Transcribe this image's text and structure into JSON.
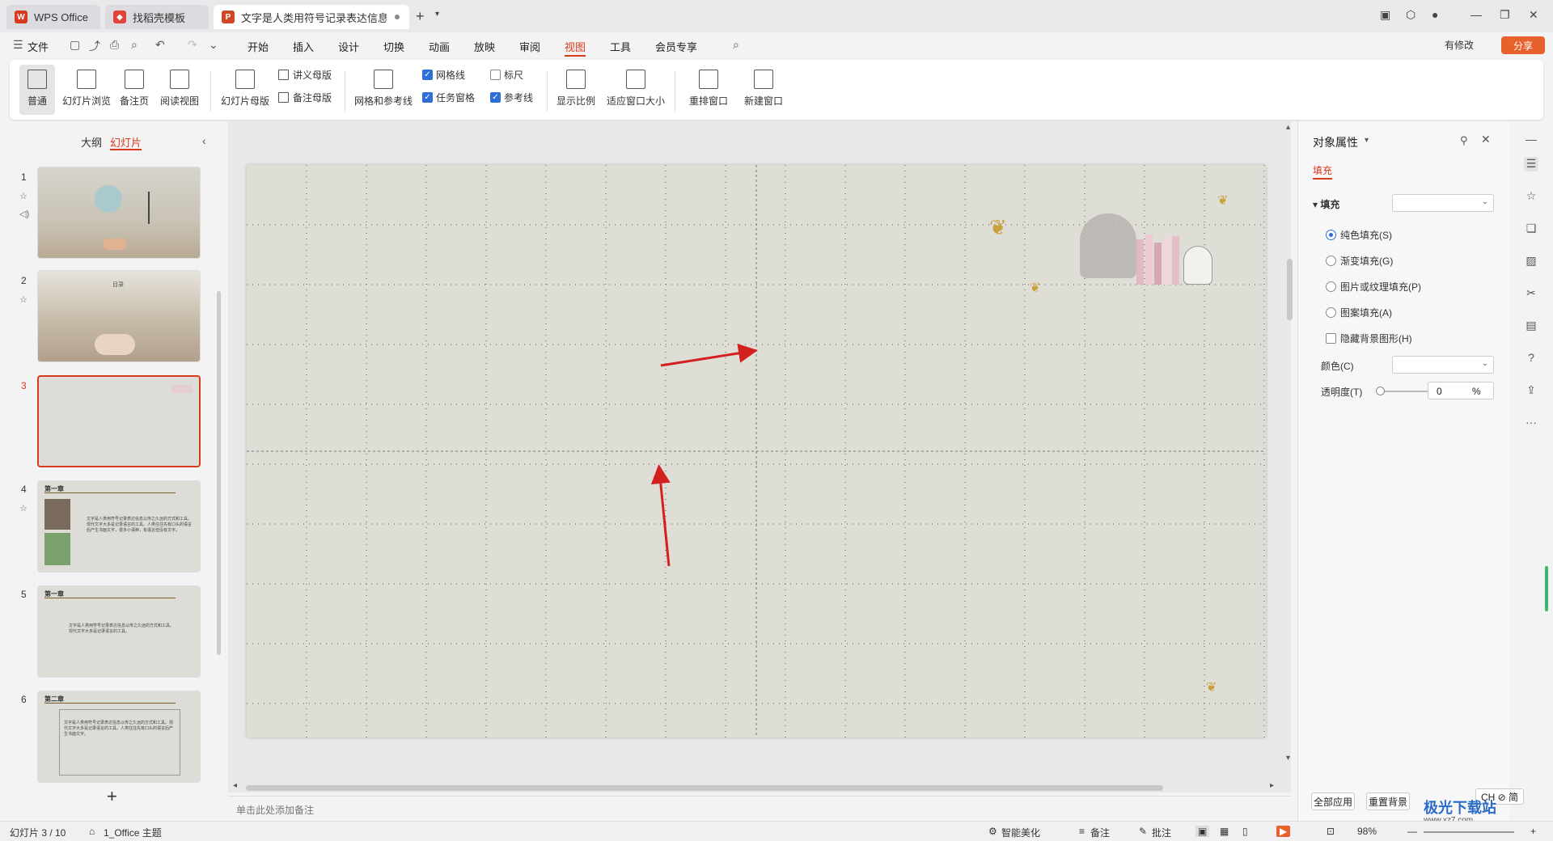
{
  "tabs": [
    {
      "label": "WPS Office",
      "icon": "wps-logo-icon",
      "color": "#d83a1f"
    },
    {
      "label": "找稻壳模板",
      "icon": "docer-icon",
      "color": "#e0443a"
    },
    {
      "label": "文字是人类用符号记录表达信息以",
      "icon": "presentation-icon",
      "color": "#d24726"
    }
  ],
  "menu": {
    "file": "文件",
    "items": [
      "开始",
      "插入",
      "设计",
      "切换",
      "动画",
      "放映",
      "审阅",
      "视图",
      "工具",
      "会员专享"
    ],
    "active": "视图",
    "modified": "有修改",
    "share": "分享"
  },
  "ribbon": {
    "normal": "普通",
    "slide_sorter": "幻灯片浏览",
    "notes_page": "备注页",
    "reading_view": "阅读视图",
    "slide_master": "幻灯片母版",
    "handout_master": "讲义母版",
    "notes_master": "备注母版",
    "grid_guides": "网格和参考线",
    "gridlines": "网格线",
    "task_pane": "任务窗格",
    "ruler": "标尺",
    "guides": "参考线",
    "zoom": "显示比例",
    "fit_window": "适应窗口大小",
    "arrange": "重排窗口",
    "new_window": "新建窗口",
    "gridlines_checked": true,
    "task_pane_checked": true,
    "ruler_checked": false,
    "guides_checked": true
  },
  "left_panel": {
    "outline_tab": "大纲",
    "slides_tab": "幻灯片",
    "slides": [
      {
        "num": "1",
        "title": "",
        "text": ""
      },
      {
        "num": "2",
        "title": "目录",
        "text": ""
      },
      {
        "num": "3",
        "title": "",
        "text": ""
      },
      {
        "num": "4",
        "title": "第一章",
        "text": "文字是人类用符号记录表达信息以传之久远的方式和工具。现代文字大多是记录语言的工具。人类往往先有口头的语言后产生书面文字，很多小语种，有语言但没有文字。"
      },
      {
        "num": "5",
        "title": "第一章",
        "text": "文字是人类用符号记录表达信息以传之久远的方式和工具。现代文字大多是记录语言的工具。"
      },
      {
        "num": "6",
        "title": "第二章",
        "text": "文字是人类用符号记录表达信息以传之久远的方式和工具。现代文字大多是记录语言的工具。人类往往先有口头的语言后产生书面文字。"
      }
    ],
    "active_slide": "3"
  },
  "notes_placeholder": "单击此处添加备注",
  "right_panel": {
    "title": "对象属性",
    "tab": "填充",
    "section": "填充",
    "options": [
      "纯色填充(S)",
      "渐变填充(G)",
      "图片或纹理填充(P)",
      "图案填充(A)"
    ],
    "selected_option": "纯色填充(S)",
    "hide_bg": "隐藏背景图形(H)",
    "color_label": "颜色(C)",
    "transparency_label": "透明度(T)",
    "transparency_value": "0",
    "percent": "%",
    "apply_all": "全部应用",
    "reset_bg": "重置背景"
  },
  "status": {
    "slide_info": "幻灯片 3 / 10",
    "theme": "1_Office 主题",
    "beautify": "智能美化",
    "notes": "备注",
    "comments": "批注",
    "zoom": "98%",
    "ime": "CH ⊘ 简"
  },
  "watermark": {
    "text": "极光下载站",
    "url": "www.xz7.com"
  },
  "colors": {
    "accent": "#d83a1f",
    "slide_bg": "#deddd6",
    "arrow": "#d41f1f",
    "checkbox": "#2d6fd6"
  }
}
